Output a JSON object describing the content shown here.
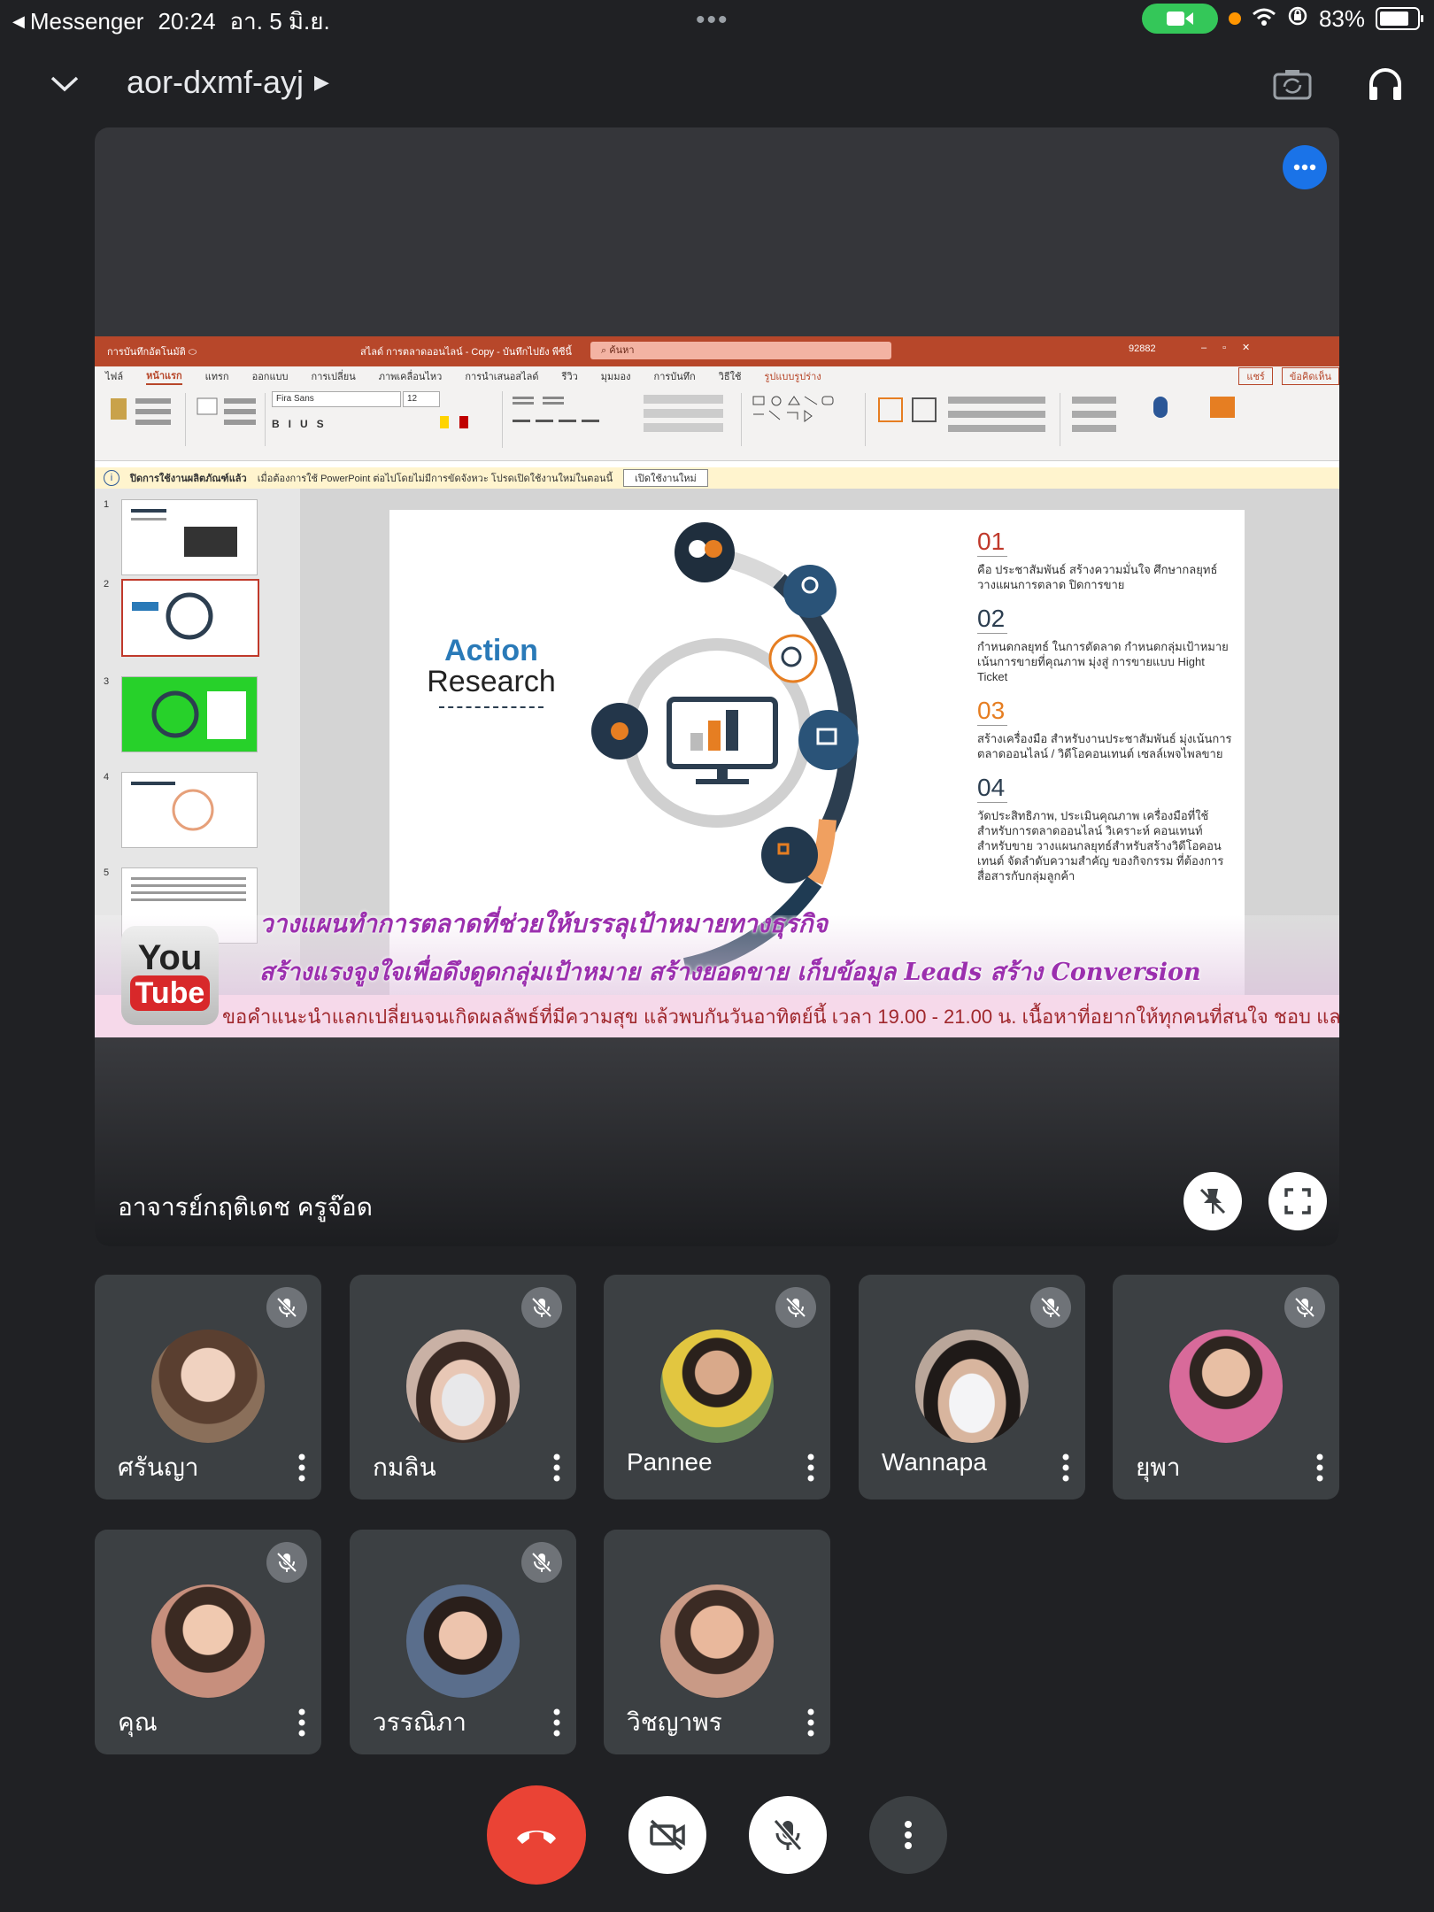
{
  "status_bar": {
    "back_app": "Messenger",
    "time": "20:24",
    "date": "อา. 5 มิ.ย.",
    "battery": "83%"
  },
  "meeting": {
    "code": "aor-dxmf-ayj",
    "presenter_name": "อาจารย์กฤติเดช ครูจ๊อด"
  },
  "shared_screen": {
    "ppt_title": "สไลด์ การตลาดออนไลน์ - Copy - บันทึกไปยัง พีซีนี้",
    "search_placeholder": "ค้นหา",
    "user_code": "92882",
    "share_label": "แชร์",
    "comment_label": "ข้อคิดเห็น",
    "tabs": [
      "ไฟล์",
      "หน้าแรก",
      "แทรก",
      "ออกแบบ",
      "การเปลี่ยน",
      "ภาพเคลื่อนไหว",
      "การนำเสนอสไลด์",
      "รีวิว",
      "มุมมอง",
      "การบันทึก",
      "วิธีใช้",
      "รูปแบบรูปร่าง"
    ],
    "font_name": "Fira Sans",
    "font_size": "12",
    "info_bar_bold": "ปิดการใช้งานผลิตภัณฑ์แล้ว",
    "info_bar_text": "เมื่อต้องการใช้ PowerPoint ต่อไปโดยไม่มีการขัดจังหวะ โปรดเปิดใช้งานใหม่ในตอนนี้",
    "info_bar_button": "เปิดใช้งานใหม่",
    "slide_numbers": [
      "1",
      "2",
      "3",
      "4",
      "5"
    ],
    "slide": {
      "heading_1": "Action",
      "heading_2": "Research",
      "items": [
        {
          "num": "01",
          "color": "#c0392b",
          "text": "คือ ประชาสัมพันธ์ สร้างความมั่นใจ ศึกษากลยุทธ์ วางแผนการตลาด ปิดการขาย"
        },
        {
          "num": "02",
          "color": "#2c3e50",
          "text": "กำหนดกลยุทธ์ ในการตัดลาด กำหนดกลุ่มเป้าหมาย เน้นการขายที่คุณภาพ มุ่งสู่ การขายแบบ Hight Ticket"
        },
        {
          "num": "03",
          "color": "#e67e22",
          "text": "สร้างเครื่องมือ สำหรับงานประชาสัมพันธ์ มุ่งเน้นการตลาดออนไลน์ / วิดีโอคอนเทนต์ เซลล์เพจไพลขาย"
        },
        {
          "num": "04",
          "color": "#2c3e50",
          "text": "วัดประสิทธิภาพ, ประเมินคุณภาพ เครื่องมือที่ใช้สำหรับการตลาดออนไลน์ วิเคราะห์ คอนเทนท์สำหรับขาย วางแผนกลยุทธ์สำหรับสร้างวิดีโอคอนเทนต์ จัดลำดับความสำคัญ ของกิจกรรม ที่ต้องการสื่อสารกับกลุ่มลูกค้า"
        }
      ]
    },
    "overlay_line_1": "วางแผนทำการตลาดที่ช่วยให้บรรลุเป้าหมายทางธุรกิจ",
    "overlay_line_2": "สร้างแรงจูงใจเพื่อดึงดูดกลุ่มเป้าหมาย สร้างยอดขาย เก็บข้อมูล Leads สร้าง Conversion",
    "ticker": "ขอคำแนะนำแลกเปลี่ยนจนเกิดผลลัพธ์ที่มีความสุข แล้วพบกันวันอาทิตย์นี้ เวลา 19.00 - 21.00 น. เนื้อหาที่อยากให้ทุกคนที่สนใจ ชอบ และมีความฝัน",
    "yt_you": "You",
    "yt_tube": "Tube"
  },
  "participants": [
    {
      "name": "ศรันญา",
      "avatar_color": "#8a6f5a"
    },
    {
      "name": "กมลิน",
      "avatar_color": "#c9b1a5"
    },
    {
      "name": "Pannee",
      "avatar_color": "#6b8c5a"
    },
    {
      "name": "Wannapa",
      "avatar_color": "#b9a69a"
    },
    {
      "name": "ยุพา",
      "avatar_color": "#d86a9a"
    },
    {
      "name": "คุณ",
      "avatar_color": "#c78f7d"
    },
    {
      "name": "วรรณิภา",
      "avatar_color": "#5a6e8c"
    },
    {
      "name": "วิชญาพร",
      "avatar_color": "#c99a86"
    }
  ],
  "colors": {
    "background": "#202124",
    "tile": "#3c4043",
    "end_call": "#ea4335",
    "accent": "#1a73e8"
  }
}
